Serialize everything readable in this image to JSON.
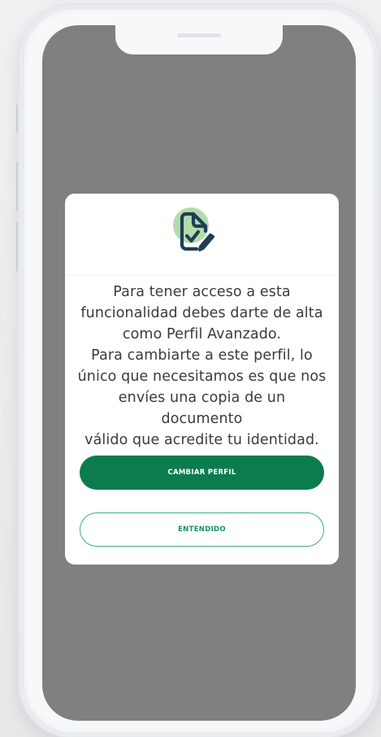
{
  "dialog": {
    "icon": "document-check-edit-icon",
    "message": "Para tener acceso a esta\nfuncionalidad debes darte de alta\ncomo Perfil Avanzado.\nPara cambiarte a este perfil, lo\núnico que necesitamos es que nos\nenvíes una copia de un documento\nválido que acredite tu identidad.",
    "primary_button_label": "CAMBIAR PERFIL",
    "secondary_button_label": "ENTENDIDO"
  },
  "colors": {
    "primary": "#0c7c4f",
    "secondary_border": "#39b07e",
    "secondary_text": "#13935d",
    "icon_stroke": "#1f3d57",
    "icon_circle": "#b4dcaa",
    "overlay": "#808080"
  }
}
